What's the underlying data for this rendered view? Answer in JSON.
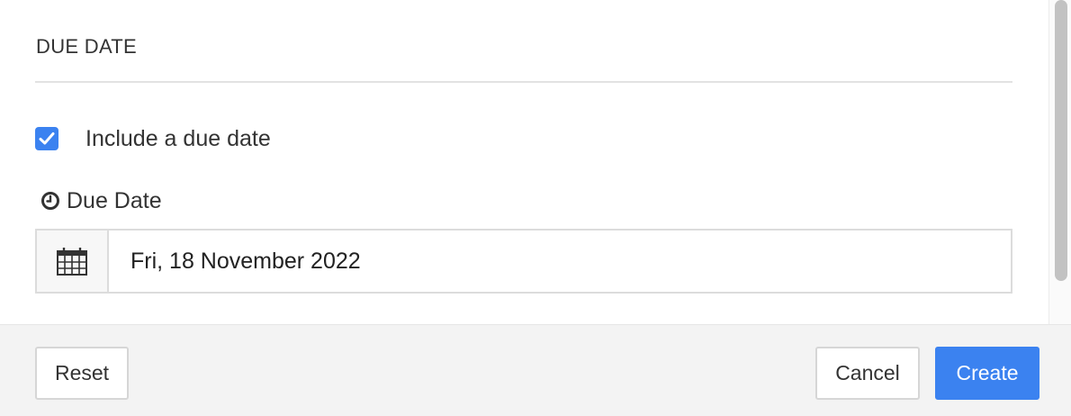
{
  "section": {
    "title": "DUE DATE"
  },
  "due_date_toggle": {
    "label": "Include a due date",
    "checked": true
  },
  "due_date_field": {
    "label": "Due Date",
    "value": "Fri, 18 November 2022",
    "label_icon": "clock-icon",
    "addon_icon": "calendar-icon"
  },
  "footer": {
    "reset_label": "Reset",
    "cancel_label": "Cancel",
    "create_label": "Create"
  },
  "colors": {
    "accent": "#3b82f0",
    "footer_bg": "#f3f3f3",
    "addon_bg": "#f7f7f7"
  }
}
